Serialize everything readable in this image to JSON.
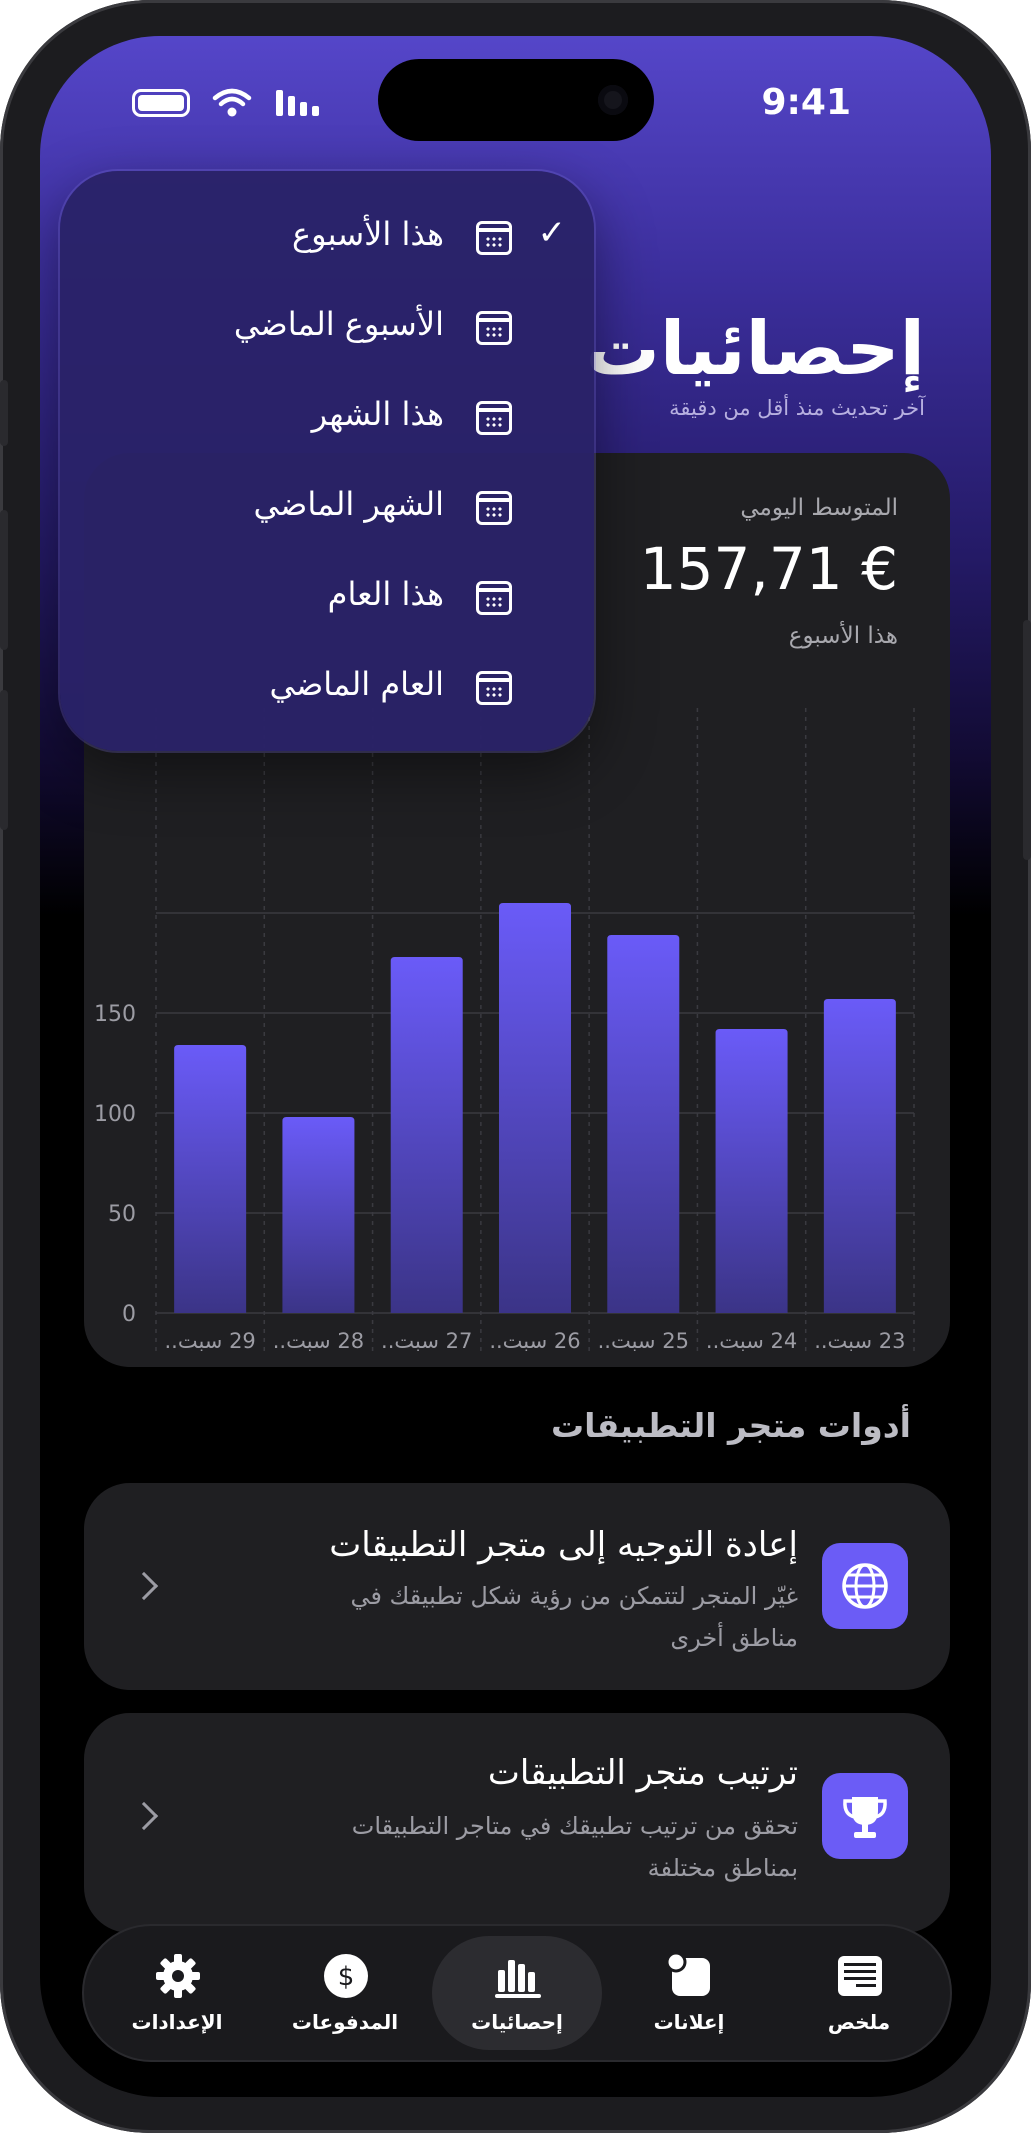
{
  "status_bar": {
    "time": "9:41"
  },
  "header": {
    "title": "إحصائيات",
    "subtitle": "آخر تحديث منذ أقل من دقيقة"
  },
  "period_menu": {
    "items": [
      {
        "label": "هذا الأسبوع",
        "selected": true
      },
      {
        "label": "الأسبوع الماضي",
        "selected": false
      },
      {
        "label": "هذا الشهر",
        "selected": false
      },
      {
        "label": "الشهر الماضي",
        "selected": false
      },
      {
        "label": "هذا العام",
        "selected": false
      },
      {
        "label": "العام الماضي",
        "selected": false
      }
    ],
    "check_mark": "✓",
    "icon": "calendar-icon"
  },
  "summary": {
    "label": "المتوسط اليومي",
    "value": "157,71 €",
    "period": "هذا الأسبوع"
  },
  "chart_data": {
    "type": "bar",
    "categories": [
      "23 سبت..",
      "24 سبت..",
      "25 سبت..",
      "26 سبت..",
      "27 سبت..",
      "28 سبت..",
      "29 سبت.."
    ],
    "values": [
      157,
      142,
      189,
      205,
      178,
      98,
      134
    ],
    "title": "",
    "xlabel": "",
    "ylabel": "",
    "yticks": [
      0,
      50,
      100,
      150
    ],
    "ylim": [
      0,
      225
    ],
    "grid": true,
    "bar_color_top": "#6a5bf8",
    "bar_color_bottom": "#3b3487"
  },
  "tools_section": {
    "title": "أدوات متجر التطبيقات",
    "items": [
      {
        "title": "إعادة التوجيه إلى متجر التطبيقات",
        "description": "غيّر المتجر لتتمكن من رؤية شكل تطبيقك في مناطق أخرى",
        "icon": "globe-icon"
      },
      {
        "title": "ترتيب متجر التطبيقات",
        "description": "تحقق من ترتيب تطبيقك في متاجر التطبيقات بمناطق مختلفة",
        "icon": "trophy-icon"
      }
    ]
  },
  "tab_bar": {
    "items": [
      {
        "label": "الإعدادات",
        "icon": "gear-icon",
        "active": false
      },
      {
        "label": "المدفوعات",
        "icon": "dollar-icon",
        "active": false
      },
      {
        "label": "إحصائيات",
        "icon": "bar-chart-icon",
        "active": true
      },
      {
        "label": "إعلانات",
        "icon": "ads-icon",
        "active": false
      },
      {
        "label": "ملخص",
        "icon": "summary-icon",
        "active": false
      }
    ]
  },
  "colors": {
    "accent": "#6b5cf6",
    "header_gradient_top": "#5546c9",
    "card_background": "#1f1f22",
    "background": "#000000"
  }
}
